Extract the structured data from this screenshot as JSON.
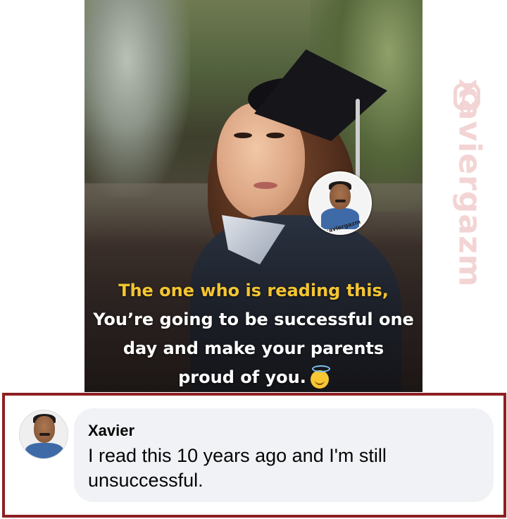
{
  "post": {
    "quote_line1": "The one who is reading this,",
    "quote_line2": "You’re going to be successful one",
    "quote_line3": "day and make your parents",
    "quote_line4": "proud of you.",
    "emoji": "smiling-face-with-halo",
    "avatar_handle": "@xaviergazm",
    "highlight_color": "#f5c531"
  },
  "watermark": {
    "text": "xaviergazm",
    "icon": "instagram-icon",
    "color": "#f3d4d4"
  },
  "comment": {
    "author": "Xavier",
    "text": "I read this 10 years ago and I'm still unsuccessful.",
    "frame_color": "#8e1f22",
    "bubble_color": "#f0f2f5"
  }
}
